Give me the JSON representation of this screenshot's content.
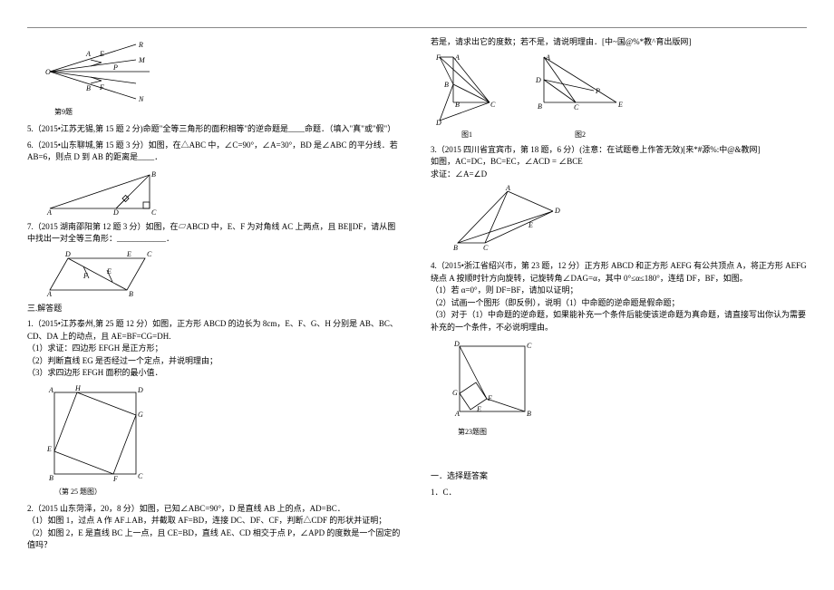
{
  "left": {
    "fig9_caption": "第9题",
    "q5": "5.（2015•江苏无锡,第 15 题 2 分)命题\"全等三角形的面积相等\"的逆命题是____命题．（填入\"真\"或\"假\"）",
    "q6": "6.（2015•山东聊城,第 15 题 3 分）如图，在△ABC 中，∠C=90°，∠A=30°，BD 是∠ABC 的平分线．若 AB=6，则点 D 到 AB 的距离是____．",
    "q7": "7.（2015 湖南邵阳第 12 题 3 分）如图，在▱ABCD 中，E、F 为对角线 AC 上两点，且 BE∥DF，请从图中找出一对全等三角形：____________．",
    "sec3": "三.解答题",
    "q3_1": "1.（2015•江苏泰州,第 25 题 12 分）如图，正方形 ABCD 的边长为 8cm，E、F、G、H 分别是 AB、BC、CD、DA 上的动点，且 AE=BF=CG=DH.",
    "q3_1_1": "（1）求证：四边形 EFGH 是正方形；",
    "q3_1_2": "（2）判断直线 EG 是否经过一个定点，并说明理由；",
    "q3_1_3": "（3）求四边形 EFGH 面积的最小值．",
    "fig25_caption": "（第 25 题图）",
    "q3_2": "2.（2015 山东菏泽，20，8 分）如图，已知∠ABC=90°，D 是直线 AB 上的点，AD=BC．",
    "q3_2_1": "（1）如图 1，过点 A 作 AF⊥AB，并截取 AF=BD，连接 DC、DF、CF，判断△CDF 的形状并证明；",
    "q3_2_2": "（2）如图 2，E 是直线 BC 上一点，且 CE=BD，直线 AE、CD 相交于点 P，∠APD 的度数是一个固定的值吗？"
  },
  "right": {
    "cont": "若是，请求出它的度数；若不是，请说明理由．[中~国@%*教^育出版网]",
    "fig1_label": "图1",
    "fig2_label": "图2",
    "q3_3": "3.（2015 四川省宜宾市，第 18 题，6 分）(注意：在试题卷上作答无效)[来*#源%:中@&教网]",
    "q3_3_given": "如图，AC=DC，BC=EC，∠ACD = ∠BCE",
    "q3_3_prove": "求证：∠A=∠D",
    "q4": "4.（2015•浙江省绍兴市，第 23 题，12 分）正方形 ABCD 和正方形 AEFG 有公共顶点 A，将正方形 AEFG 绕点 A 按顺时针方向旋转，记旋转角∠DAG=α，其中 0°≤α≤180°，连结 DF，BF，如图。",
    "q4_1": "（1）若 α=0°，则 DF=BF，请加以证明；",
    "q4_2": "（2）试画一个图形（即反例），说明（1）中命题的逆命题是假命题；",
    "q4_3": "（3）对于（1）中命题的逆命题，如果能补充一个条件后能使该逆命题为真命题，请直接写出你认为需要补充的一个条件，不必说明理由。",
    "fig23_caption": "第23题图",
    "ans_sec": "一．选择题答案",
    "ans1": "1．C．"
  }
}
